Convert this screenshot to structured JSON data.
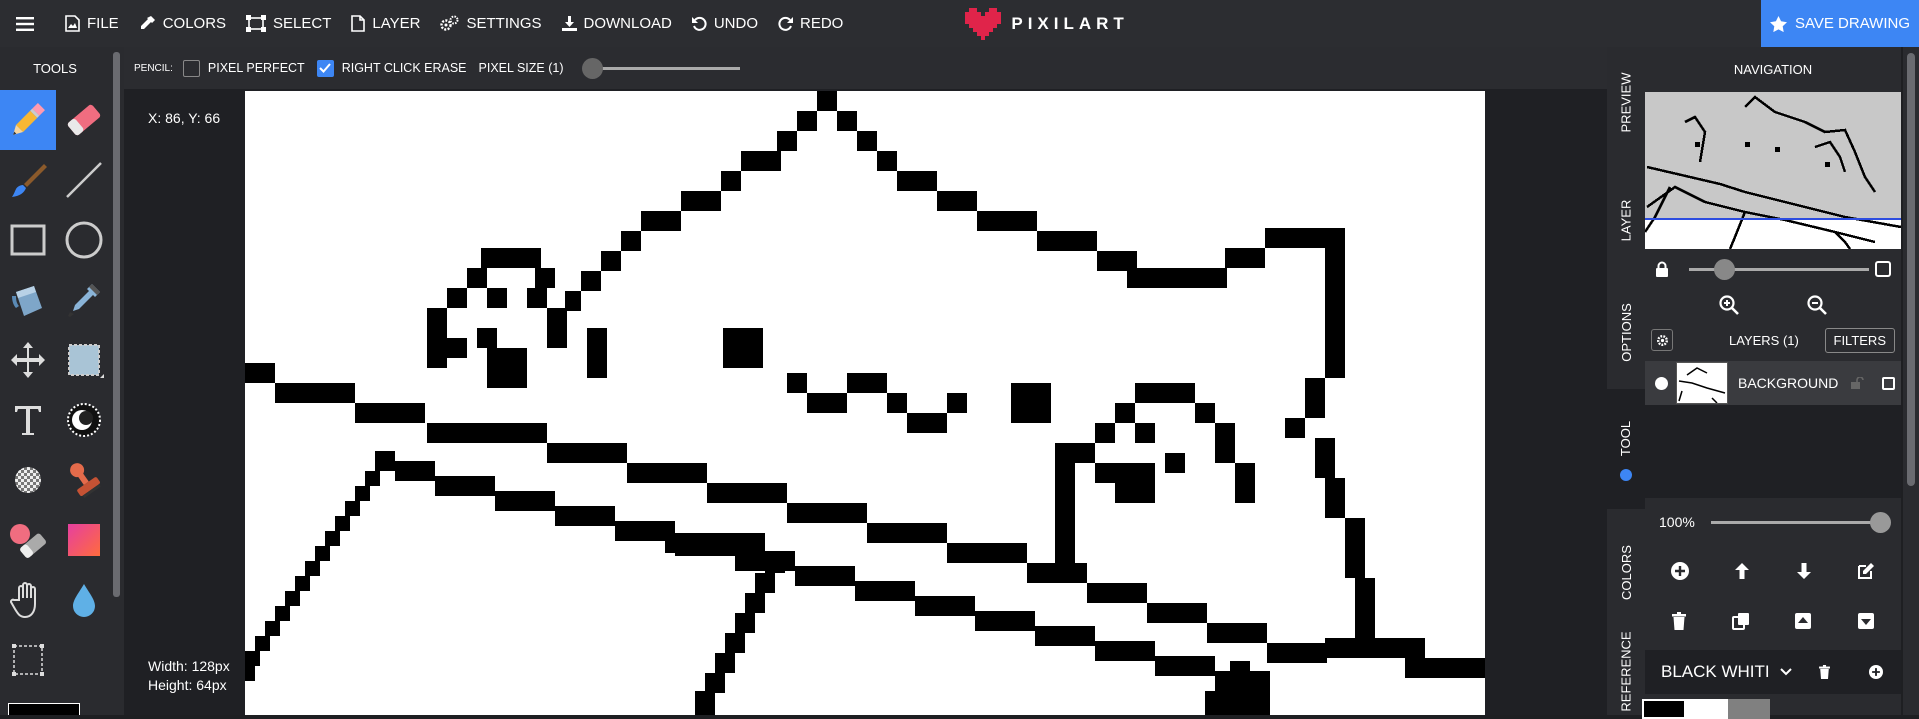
{
  "topbar": {
    "file": "FILE",
    "colors": "COLORS",
    "select": "SELECT",
    "layer": "LAYER",
    "settings": "SETTINGS",
    "download": "DOWNLOAD",
    "undo": "UNDO",
    "redo": "REDO",
    "logo": "PIXILART",
    "save": "SAVE DRAWING"
  },
  "tools": {
    "title": "TOOLS",
    "items": [
      "pencil-icon",
      "eraser-icon",
      "brush-icon",
      "line-icon",
      "rectangle-icon",
      "circle-icon",
      "bucket-icon",
      "eyedropper-icon",
      "move-icon",
      "select-area-icon",
      "text-icon",
      "lighten-icon",
      "dither-icon",
      "stamp-icon",
      "mirror-eraser-icon",
      "gradient-icon",
      "hand-icon",
      "blur-drop-icon",
      "crop-icon"
    ],
    "active": "pencil-icon"
  },
  "options": {
    "tool_label": "PENCIL:",
    "pixel_perfect": "PIXEL PERFECT",
    "pixel_perfect_checked": false,
    "right_click_erase": "RIGHT CLICK ERASE",
    "right_click_erase_checked": true,
    "pixel_size": "PIXEL SIZE (1)"
  },
  "canvas": {
    "coords": "X: 86, Y: 66",
    "width": "Width: 128px",
    "height": "Height: 64px"
  },
  "right_tabs": [
    "PREVIEW",
    "LAYER",
    "OPTIONS",
    "TOOL",
    "COLORS",
    "REFERENCE"
  ],
  "right_tabs_active": "TOOL",
  "navigation": {
    "title": "NAVIGATION"
  },
  "layers": {
    "title": "LAYERS (1)",
    "filters": "FILTERS",
    "items": [
      {
        "name": "BACKGROUND"
      }
    ],
    "opacity": "100%"
  },
  "palette": {
    "name": "BLACK WHITI"
  },
  "colors": {
    "accent": "#3d86f4",
    "logo_heart": "#e0244a"
  }
}
